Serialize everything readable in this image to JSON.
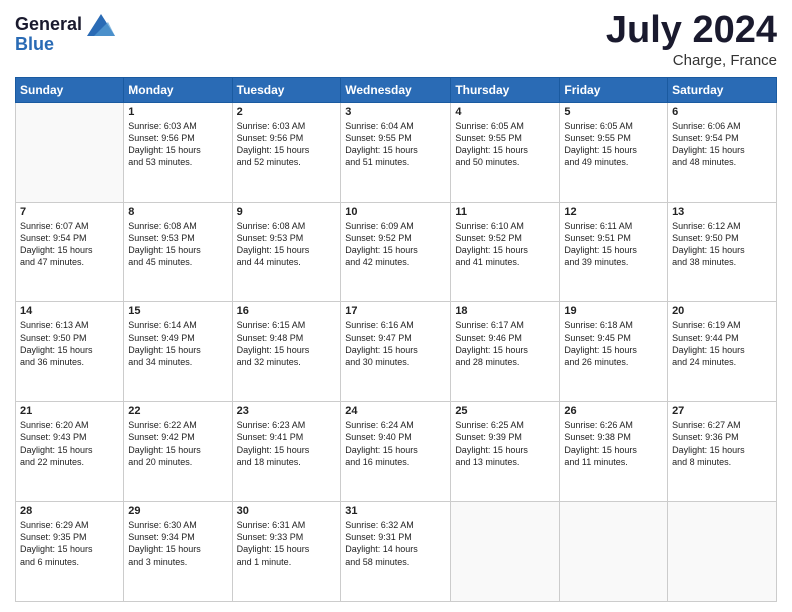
{
  "header": {
    "logo_line1": "General",
    "logo_line2": "Blue",
    "month": "July 2024",
    "location": "Charge, France"
  },
  "days_of_week": [
    "Sunday",
    "Monday",
    "Tuesday",
    "Wednesday",
    "Thursday",
    "Friday",
    "Saturday"
  ],
  "weeks": [
    [
      {
        "day": "",
        "text": ""
      },
      {
        "day": "1",
        "text": "Sunrise: 6:03 AM\nSunset: 9:56 PM\nDaylight: 15 hours\nand 53 minutes."
      },
      {
        "day": "2",
        "text": "Sunrise: 6:03 AM\nSunset: 9:56 PM\nDaylight: 15 hours\nand 52 minutes."
      },
      {
        "day": "3",
        "text": "Sunrise: 6:04 AM\nSunset: 9:55 PM\nDaylight: 15 hours\nand 51 minutes."
      },
      {
        "day": "4",
        "text": "Sunrise: 6:05 AM\nSunset: 9:55 PM\nDaylight: 15 hours\nand 50 minutes."
      },
      {
        "day": "5",
        "text": "Sunrise: 6:05 AM\nSunset: 9:55 PM\nDaylight: 15 hours\nand 49 minutes."
      },
      {
        "day": "6",
        "text": "Sunrise: 6:06 AM\nSunset: 9:54 PM\nDaylight: 15 hours\nand 48 minutes."
      }
    ],
    [
      {
        "day": "7",
        "text": "Sunrise: 6:07 AM\nSunset: 9:54 PM\nDaylight: 15 hours\nand 47 minutes."
      },
      {
        "day": "8",
        "text": "Sunrise: 6:08 AM\nSunset: 9:53 PM\nDaylight: 15 hours\nand 45 minutes."
      },
      {
        "day": "9",
        "text": "Sunrise: 6:08 AM\nSunset: 9:53 PM\nDaylight: 15 hours\nand 44 minutes."
      },
      {
        "day": "10",
        "text": "Sunrise: 6:09 AM\nSunset: 9:52 PM\nDaylight: 15 hours\nand 42 minutes."
      },
      {
        "day": "11",
        "text": "Sunrise: 6:10 AM\nSunset: 9:52 PM\nDaylight: 15 hours\nand 41 minutes."
      },
      {
        "day": "12",
        "text": "Sunrise: 6:11 AM\nSunset: 9:51 PM\nDaylight: 15 hours\nand 39 minutes."
      },
      {
        "day": "13",
        "text": "Sunrise: 6:12 AM\nSunset: 9:50 PM\nDaylight: 15 hours\nand 38 minutes."
      }
    ],
    [
      {
        "day": "14",
        "text": "Sunrise: 6:13 AM\nSunset: 9:50 PM\nDaylight: 15 hours\nand 36 minutes."
      },
      {
        "day": "15",
        "text": "Sunrise: 6:14 AM\nSunset: 9:49 PM\nDaylight: 15 hours\nand 34 minutes."
      },
      {
        "day": "16",
        "text": "Sunrise: 6:15 AM\nSunset: 9:48 PM\nDaylight: 15 hours\nand 32 minutes."
      },
      {
        "day": "17",
        "text": "Sunrise: 6:16 AM\nSunset: 9:47 PM\nDaylight: 15 hours\nand 30 minutes."
      },
      {
        "day": "18",
        "text": "Sunrise: 6:17 AM\nSunset: 9:46 PM\nDaylight: 15 hours\nand 28 minutes."
      },
      {
        "day": "19",
        "text": "Sunrise: 6:18 AM\nSunset: 9:45 PM\nDaylight: 15 hours\nand 26 minutes."
      },
      {
        "day": "20",
        "text": "Sunrise: 6:19 AM\nSunset: 9:44 PM\nDaylight: 15 hours\nand 24 minutes."
      }
    ],
    [
      {
        "day": "21",
        "text": "Sunrise: 6:20 AM\nSunset: 9:43 PM\nDaylight: 15 hours\nand 22 minutes."
      },
      {
        "day": "22",
        "text": "Sunrise: 6:22 AM\nSunset: 9:42 PM\nDaylight: 15 hours\nand 20 minutes."
      },
      {
        "day": "23",
        "text": "Sunrise: 6:23 AM\nSunset: 9:41 PM\nDaylight: 15 hours\nand 18 minutes."
      },
      {
        "day": "24",
        "text": "Sunrise: 6:24 AM\nSunset: 9:40 PM\nDaylight: 15 hours\nand 16 minutes."
      },
      {
        "day": "25",
        "text": "Sunrise: 6:25 AM\nSunset: 9:39 PM\nDaylight: 15 hours\nand 13 minutes."
      },
      {
        "day": "26",
        "text": "Sunrise: 6:26 AM\nSunset: 9:38 PM\nDaylight: 15 hours\nand 11 minutes."
      },
      {
        "day": "27",
        "text": "Sunrise: 6:27 AM\nSunset: 9:36 PM\nDaylight: 15 hours\nand 8 minutes."
      }
    ],
    [
      {
        "day": "28",
        "text": "Sunrise: 6:29 AM\nSunset: 9:35 PM\nDaylight: 15 hours\nand 6 minutes."
      },
      {
        "day": "29",
        "text": "Sunrise: 6:30 AM\nSunset: 9:34 PM\nDaylight: 15 hours\nand 3 minutes."
      },
      {
        "day": "30",
        "text": "Sunrise: 6:31 AM\nSunset: 9:33 PM\nDaylight: 15 hours\nand 1 minute."
      },
      {
        "day": "31",
        "text": "Sunrise: 6:32 AM\nSunset: 9:31 PM\nDaylight: 14 hours\nand 58 minutes."
      },
      {
        "day": "",
        "text": ""
      },
      {
        "day": "",
        "text": ""
      },
      {
        "day": "",
        "text": ""
      }
    ]
  ]
}
